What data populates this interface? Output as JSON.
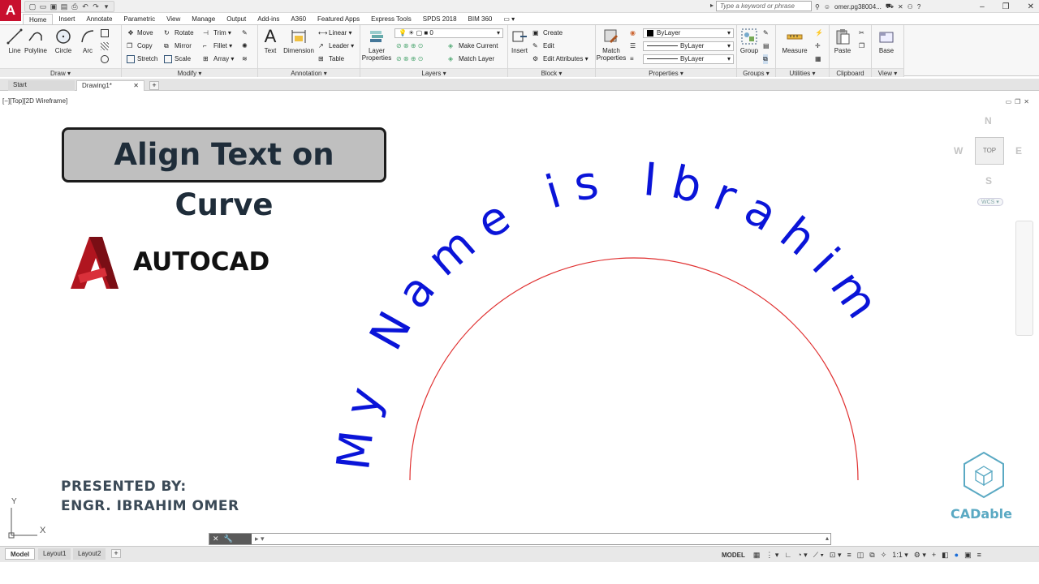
{
  "app": {
    "logo_letter": "A",
    "search_placeholder": "Type a keyword or phrase",
    "user_name": "omer.pg38004...",
    "window_controls": [
      "–",
      "❐",
      "✕"
    ]
  },
  "ribbon_tabs": [
    "Home",
    "Insert",
    "Annotate",
    "Parametric",
    "View",
    "Manage",
    "Output",
    "Add-ins",
    "A360",
    "Featured Apps",
    "Express Tools",
    "SPDS 2018",
    "BIM 360",
    "▭ ▾"
  ],
  "ribbon": {
    "draw": {
      "title": "Draw ▾",
      "line": "Line",
      "polyline": "Polyline",
      "circle": "Circle",
      "arc": "Arc"
    },
    "modify": {
      "title": "Modify ▾",
      "move": "Move",
      "rotate": "Rotate",
      "trim": "Trim ▾",
      "copy": "Copy",
      "mirror": "Mirror",
      "fillet": "Fillet ▾",
      "stretch": "Stretch",
      "scale": "Scale",
      "array": "Array ▾"
    },
    "annotation": {
      "title": "Annotation ▾",
      "text": "Text",
      "dimension": "Dimension",
      "linear": "Linear ▾",
      "leader": "Leader ▾",
      "table": "Table"
    },
    "layers": {
      "title": "Layers ▾",
      "layer_properties": "Layer Properties",
      "current_layer": "0",
      "make_current": "Make Current",
      "match_layer": "Match Layer"
    },
    "block": {
      "title": "Block ▾",
      "insert": "Insert",
      "create": "Create",
      "edit": "Edit",
      "edit_attributes": "Edit Attributes ▾"
    },
    "properties": {
      "title": "Properties ▾",
      "match_properties": "Match Properties",
      "color": "ByLayer",
      "linetype": "ByLayer",
      "lineweight": "ByLayer"
    },
    "groups": {
      "title": "Groups ▾",
      "group": "Group"
    },
    "utilities": {
      "title": "Utilities ▾",
      "measure": "Measure"
    },
    "clipboard": {
      "title": "Clipboard",
      "paste": "Paste"
    },
    "view": {
      "title": "View ▾",
      "base": "Base"
    }
  },
  "doc_tabs": {
    "start": "Start",
    "drawing": "Drawing1*",
    "close": "✕",
    "add": "+"
  },
  "viewport": {
    "label": "[−][Top][2D Wireframe]"
  },
  "canvas": {
    "title": "Align Text on Curve",
    "brand": "AUTOCAD",
    "presented_by": "PRESENTED BY:",
    "presenter_name": "ENGR. IBRAHIM OMER",
    "curve_text": "My Name is Ibrahim",
    "cadable": "CADable",
    "ucs_y": "Y",
    "ucs_x": "X",
    "text_color": "#0a14d8",
    "arc_color": "#e03030"
  },
  "viewcube": {
    "n": "N",
    "s": "S",
    "e": "E",
    "w": "W",
    "top": "TOP",
    "wcs": "WCS ▾"
  },
  "command_line": {
    "prompt": "▸ ▾"
  },
  "status": {
    "layouts": [
      "Model",
      "Layout1",
      "Layout2"
    ],
    "add": "+",
    "model_indicator": "MODEL",
    "scale": "1:1 ▾"
  }
}
